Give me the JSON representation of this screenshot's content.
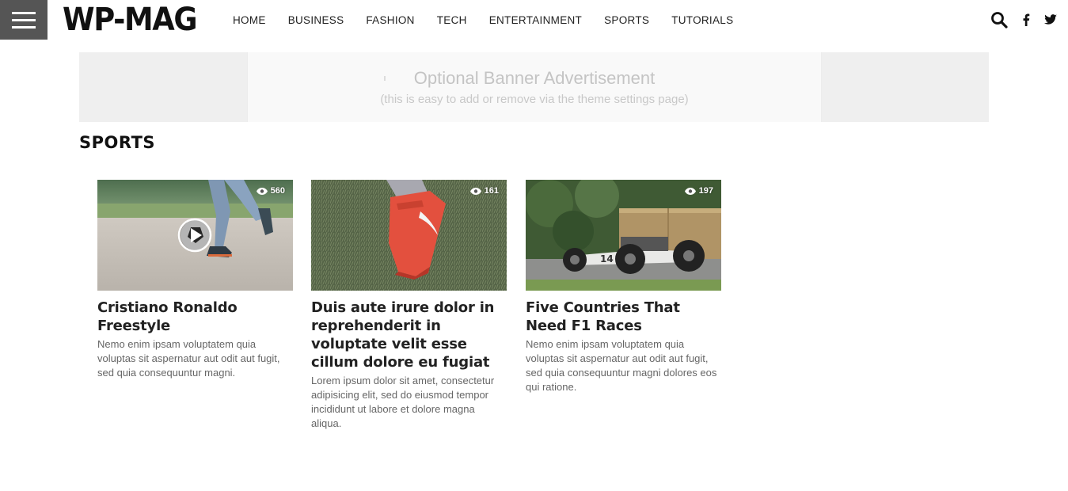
{
  "logo": {
    "text": "WP-MAG"
  },
  "nav": {
    "items": [
      "HOME",
      "BUSINESS",
      "FASHION",
      "TECH",
      "ENTERTAINMENT",
      "SPORTS",
      "TUTORIALS"
    ]
  },
  "banner": {
    "title": "Optional Banner Advertisement",
    "subtitle": "(this is easy to add or remove via the theme settings page)"
  },
  "section": {
    "title": "SPORTS"
  },
  "posts": [
    {
      "title": "Cristiano Ronaldo Freestyle",
      "excerpt": "Nemo enim ipsam voluptatem quia voluptas sit aspernatur aut odit aut fugit, sed quia consequuntur magni.",
      "views": "560",
      "has_video": true,
      "image": "soccer-ball-kick"
    },
    {
      "title": "Duis aute irure dolor in reprehenderit in voluptate velit esse cillum dolore eu fugiat",
      "excerpt": "Lorem ipsum dolor sit amet, consectetur adipisicing elit, sed do eiusmod tempor incididunt ut labore et dolore magna aliqua.",
      "views": "161",
      "has_video": false,
      "image": "red-football-boot"
    },
    {
      "title": "Five Countries That Need F1 Races",
      "excerpt": "Nemo enim ipsam voluptatem quia voluptas sit aspernatur aut odit aut fugit, sed quia consequuntur magni dolores eos qui ratione.",
      "views": "197",
      "has_video": false,
      "image": "vintage-race-car"
    }
  ],
  "icons": {
    "menu": "hamburger-menu-icon",
    "search": "search-icon",
    "facebook": "facebook-icon",
    "twitter": "twitter-icon",
    "views": "eye-icon",
    "play": "play-icon"
  },
  "colors": {
    "menu_bg": "#555555",
    "banner_bg": "#efefef",
    "banner_inner_bg": "#f9f9f9",
    "text": "#222222",
    "excerpt": "#666666"
  }
}
